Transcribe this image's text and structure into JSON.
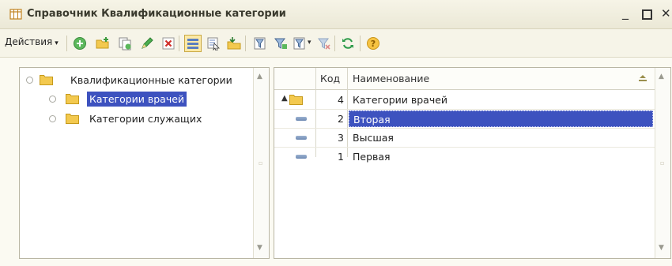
{
  "window": {
    "title": "Справочник Квалификационные категории",
    "controls": {
      "minimize": "_",
      "close": "✕"
    }
  },
  "toolbar": {
    "actions_label": "Действия",
    "actions_caret": "▾",
    "icons": [
      "add-icon",
      "add-group-icon",
      "copy-icon",
      "edit-icon",
      "delete-icon",
      "hierarchy-list-icon",
      "hierarchy-view-icon",
      "move-to-group-icon",
      "filter-settings-icon",
      "filter-by-value-icon",
      "filter-dropdown-icon",
      "clear-filter-icon",
      "refresh-icon",
      "help-icon"
    ]
  },
  "tree": {
    "items": [
      {
        "label": "Квалификационные категории",
        "level": 0,
        "selected": false
      },
      {
        "label": "Категории врачей",
        "level": 1,
        "selected": true
      },
      {
        "label": "Категории служащих",
        "level": 1,
        "selected": false
      }
    ]
  },
  "grid": {
    "columns": {
      "code": "Код",
      "name": "Наименование"
    },
    "rows": [
      {
        "type": "group-up",
        "code": "4",
        "name": "Категории врачей",
        "selected": false
      },
      {
        "type": "item",
        "code": "2",
        "name": "Вторая",
        "selected": true
      },
      {
        "type": "item",
        "code": "3",
        "name": "Высшая",
        "selected": false
      },
      {
        "type": "item",
        "code": "1",
        "name": "Первая",
        "selected": false
      }
    ]
  },
  "scroll": {
    "up": "▲",
    "down": "▼"
  },
  "colors": {
    "selection": "#3d52bf",
    "folder": "#f3c94f",
    "window_bg": "#fbfaf2"
  }
}
